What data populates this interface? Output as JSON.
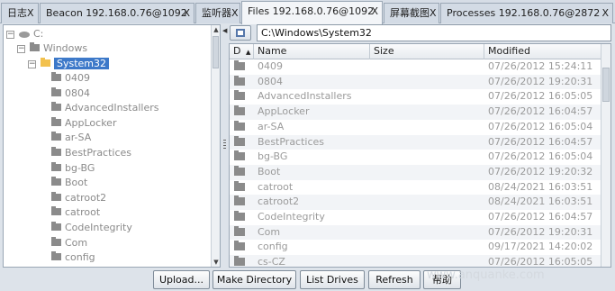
{
  "tabs": [
    {
      "label": "日志X",
      "close": ""
    },
    {
      "label": "Beacon 192.168.0.76@1092",
      "close": "X"
    },
    {
      "label": "监听器X",
      "close": ""
    },
    {
      "label": "Files 192.168.0.76@1092",
      "close": "X",
      "active": true
    },
    {
      "label": "屏幕截图X",
      "close": ""
    },
    {
      "label": "Processes 192.168.0.76@2872",
      "close": "X"
    }
  ],
  "tree": {
    "drive": "C:",
    "windows": "Windows",
    "selected": "System32",
    "children": [
      "0409",
      "0804",
      "AdvancedInstallers",
      "AppLocker",
      "ar-SA",
      "BestPractices",
      "bg-BG",
      "Boot",
      "catroot2",
      "catroot",
      "CodeIntegrity",
      "Com",
      "config"
    ]
  },
  "path": "C:\\Windows\\System32",
  "columns": {
    "d": "D",
    "sort": "▲",
    "name": "Name",
    "size": "Size",
    "modified": "Modified"
  },
  "files": [
    {
      "name": "0409",
      "size": "",
      "modified": "07/26/2012 15:24:11"
    },
    {
      "name": "0804",
      "size": "",
      "modified": "07/26/2012 19:20:31"
    },
    {
      "name": "AdvancedInstallers",
      "size": "",
      "modified": "07/26/2012 16:05:05"
    },
    {
      "name": "AppLocker",
      "size": "",
      "modified": "07/26/2012 16:04:57"
    },
    {
      "name": "ar-SA",
      "size": "",
      "modified": "07/26/2012 16:05:04"
    },
    {
      "name": "BestPractices",
      "size": "",
      "modified": "07/26/2012 16:04:57"
    },
    {
      "name": "bg-BG",
      "size": "",
      "modified": "07/26/2012 16:05:04"
    },
    {
      "name": "Boot",
      "size": "",
      "modified": "07/26/2012 19:20:32"
    },
    {
      "name": "catroot",
      "size": "",
      "modified": "08/24/2021 16:03:51"
    },
    {
      "name": "catroot2",
      "size": "",
      "modified": "08/24/2021 16:03:51"
    },
    {
      "name": "CodeIntegrity",
      "size": "",
      "modified": "07/26/2012 16:04:57"
    },
    {
      "name": "Com",
      "size": "",
      "modified": "07/26/2012 19:20:31"
    },
    {
      "name": "config",
      "size": "",
      "modified": "09/17/2021 14:20:02"
    },
    {
      "name": "cs-CZ",
      "size": "",
      "modified": "07/26/2012 16:05:05"
    }
  ],
  "buttons": {
    "upload": "Upload...",
    "make_directory": "Make Directory",
    "list_drives": "List Drives",
    "refresh": "Refresh",
    "help": "帮助"
  },
  "watermark": "www.anquanke.com"
}
